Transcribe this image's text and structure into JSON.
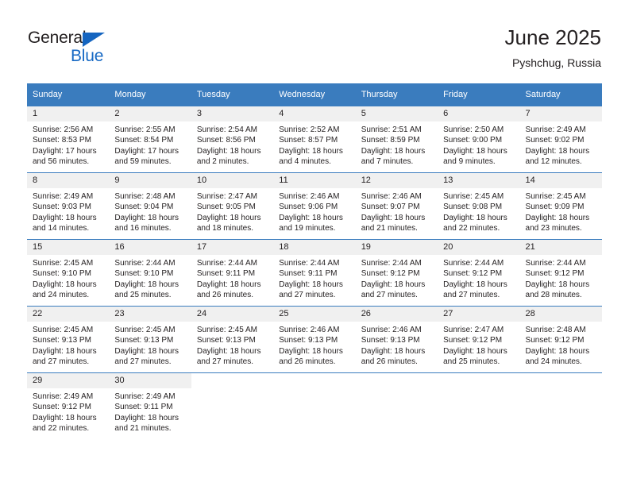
{
  "brand": {
    "name_part1": "General",
    "name_part2": "Blue",
    "color_dark": "#231f20",
    "color_blue": "#1769c4"
  },
  "header": {
    "title": "June 2025",
    "location": "Pyshchug, Russia"
  },
  "theme": {
    "header_bg": "#3a7cbe",
    "daynum_bg": "#f0f0f0",
    "text": "#231f20"
  },
  "weekdays": [
    "Sunday",
    "Monday",
    "Tuesday",
    "Wednesday",
    "Thursday",
    "Friday",
    "Saturday"
  ],
  "weeks": [
    [
      {
        "day": "1",
        "sunrise": "Sunrise: 2:56 AM",
        "sunset": "Sunset: 8:53 PM",
        "daylight1": "Daylight: 17 hours",
        "daylight2": "and 56 minutes."
      },
      {
        "day": "2",
        "sunrise": "Sunrise: 2:55 AM",
        "sunset": "Sunset: 8:54 PM",
        "daylight1": "Daylight: 17 hours",
        "daylight2": "and 59 minutes."
      },
      {
        "day": "3",
        "sunrise": "Sunrise: 2:54 AM",
        "sunset": "Sunset: 8:56 PM",
        "daylight1": "Daylight: 18 hours",
        "daylight2": "and 2 minutes."
      },
      {
        "day": "4",
        "sunrise": "Sunrise: 2:52 AM",
        "sunset": "Sunset: 8:57 PM",
        "daylight1": "Daylight: 18 hours",
        "daylight2": "and 4 minutes."
      },
      {
        "day": "5",
        "sunrise": "Sunrise: 2:51 AM",
        "sunset": "Sunset: 8:59 PM",
        "daylight1": "Daylight: 18 hours",
        "daylight2": "and 7 minutes."
      },
      {
        "day": "6",
        "sunrise": "Sunrise: 2:50 AM",
        "sunset": "Sunset: 9:00 PM",
        "daylight1": "Daylight: 18 hours",
        "daylight2": "and 9 minutes."
      },
      {
        "day": "7",
        "sunrise": "Sunrise: 2:49 AM",
        "sunset": "Sunset: 9:02 PM",
        "daylight1": "Daylight: 18 hours",
        "daylight2": "and 12 minutes."
      }
    ],
    [
      {
        "day": "8",
        "sunrise": "Sunrise: 2:49 AM",
        "sunset": "Sunset: 9:03 PM",
        "daylight1": "Daylight: 18 hours",
        "daylight2": "and 14 minutes."
      },
      {
        "day": "9",
        "sunrise": "Sunrise: 2:48 AM",
        "sunset": "Sunset: 9:04 PM",
        "daylight1": "Daylight: 18 hours",
        "daylight2": "and 16 minutes."
      },
      {
        "day": "10",
        "sunrise": "Sunrise: 2:47 AM",
        "sunset": "Sunset: 9:05 PM",
        "daylight1": "Daylight: 18 hours",
        "daylight2": "and 18 minutes."
      },
      {
        "day": "11",
        "sunrise": "Sunrise: 2:46 AM",
        "sunset": "Sunset: 9:06 PM",
        "daylight1": "Daylight: 18 hours",
        "daylight2": "and 19 minutes."
      },
      {
        "day": "12",
        "sunrise": "Sunrise: 2:46 AM",
        "sunset": "Sunset: 9:07 PM",
        "daylight1": "Daylight: 18 hours",
        "daylight2": "and 21 minutes."
      },
      {
        "day": "13",
        "sunrise": "Sunrise: 2:45 AM",
        "sunset": "Sunset: 9:08 PM",
        "daylight1": "Daylight: 18 hours",
        "daylight2": "and 22 minutes."
      },
      {
        "day": "14",
        "sunrise": "Sunrise: 2:45 AM",
        "sunset": "Sunset: 9:09 PM",
        "daylight1": "Daylight: 18 hours",
        "daylight2": "and 23 minutes."
      }
    ],
    [
      {
        "day": "15",
        "sunrise": "Sunrise: 2:45 AM",
        "sunset": "Sunset: 9:10 PM",
        "daylight1": "Daylight: 18 hours",
        "daylight2": "and 24 minutes."
      },
      {
        "day": "16",
        "sunrise": "Sunrise: 2:44 AM",
        "sunset": "Sunset: 9:10 PM",
        "daylight1": "Daylight: 18 hours",
        "daylight2": "and 25 minutes."
      },
      {
        "day": "17",
        "sunrise": "Sunrise: 2:44 AM",
        "sunset": "Sunset: 9:11 PM",
        "daylight1": "Daylight: 18 hours",
        "daylight2": "and 26 minutes."
      },
      {
        "day": "18",
        "sunrise": "Sunrise: 2:44 AM",
        "sunset": "Sunset: 9:11 PM",
        "daylight1": "Daylight: 18 hours",
        "daylight2": "and 27 minutes."
      },
      {
        "day": "19",
        "sunrise": "Sunrise: 2:44 AM",
        "sunset": "Sunset: 9:12 PM",
        "daylight1": "Daylight: 18 hours",
        "daylight2": "and 27 minutes."
      },
      {
        "day": "20",
        "sunrise": "Sunrise: 2:44 AM",
        "sunset": "Sunset: 9:12 PM",
        "daylight1": "Daylight: 18 hours",
        "daylight2": "and 27 minutes."
      },
      {
        "day": "21",
        "sunrise": "Sunrise: 2:44 AM",
        "sunset": "Sunset: 9:12 PM",
        "daylight1": "Daylight: 18 hours",
        "daylight2": "and 28 minutes."
      }
    ],
    [
      {
        "day": "22",
        "sunrise": "Sunrise: 2:45 AM",
        "sunset": "Sunset: 9:13 PM",
        "daylight1": "Daylight: 18 hours",
        "daylight2": "and 27 minutes."
      },
      {
        "day": "23",
        "sunrise": "Sunrise: 2:45 AM",
        "sunset": "Sunset: 9:13 PM",
        "daylight1": "Daylight: 18 hours",
        "daylight2": "and 27 minutes."
      },
      {
        "day": "24",
        "sunrise": "Sunrise: 2:45 AM",
        "sunset": "Sunset: 9:13 PM",
        "daylight1": "Daylight: 18 hours",
        "daylight2": "and 27 minutes."
      },
      {
        "day": "25",
        "sunrise": "Sunrise: 2:46 AM",
        "sunset": "Sunset: 9:13 PM",
        "daylight1": "Daylight: 18 hours",
        "daylight2": "and 26 minutes."
      },
      {
        "day": "26",
        "sunrise": "Sunrise: 2:46 AM",
        "sunset": "Sunset: 9:13 PM",
        "daylight1": "Daylight: 18 hours",
        "daylight2": "and 26 minutes."
      },
      {
        "day": "27",
        "sunrise": "Sunrise: 2:47 AM",
        "sunset": "Sunset: 9:12 PM",
        "daylight1": "Daylight: 18 hours",
        "daylight2": "and 25 minutes."
      },
      {
        "day": "28",
        "sunrise": "Sunrise: 2:48 AM",
        "sunset": "Sunset: 9:12 PM",
        "daylight1": "Daylight: 18 hours",
        "daylight2": "and 24 minutes."
      }
    ],
    [
      {
        "day": "29",
        "sunrise": "Sunrise: 2:49 AM",
        "sunset": "Sunset: 9:12 PM",
        "daylight1": "Daylight: 18 hours",
        "daylight2": "and 22 minutes."
      },
      {
        "day": "30",
        "sunrise": "Sunrise: 2:49 AM",
        "sunset": "Sunset: 9:11 PM",
        "daylight1": "Daylight: 18 hours",
        "daylight2": "and 21 minutes."
      },
      {
        "day": "",
        "sunrise": "",
        "sunset": "",
        "daylight1": "",
        "daylight2": ""
      },
      {
        "day": "",
        "sunrise": "",
        "sunset": "",
        "daylight1": "",
        "daylight2": ""
      },
      {
        "day": "",
        "sunrise": "",
        "sunset": "",
        "daylight1": "",
        "daylight2": ""
      },
      {
        "day": "",
        "sunrise": "",
        "sunset": "",
        "daylight1": "",
        "daylight2": ""
      },
      {
        "day": "",
        "sunrise": "",
        "sunset": "",
        "daylight1": "",
        "daylight2": ""
      }
    ]
  ]
}
